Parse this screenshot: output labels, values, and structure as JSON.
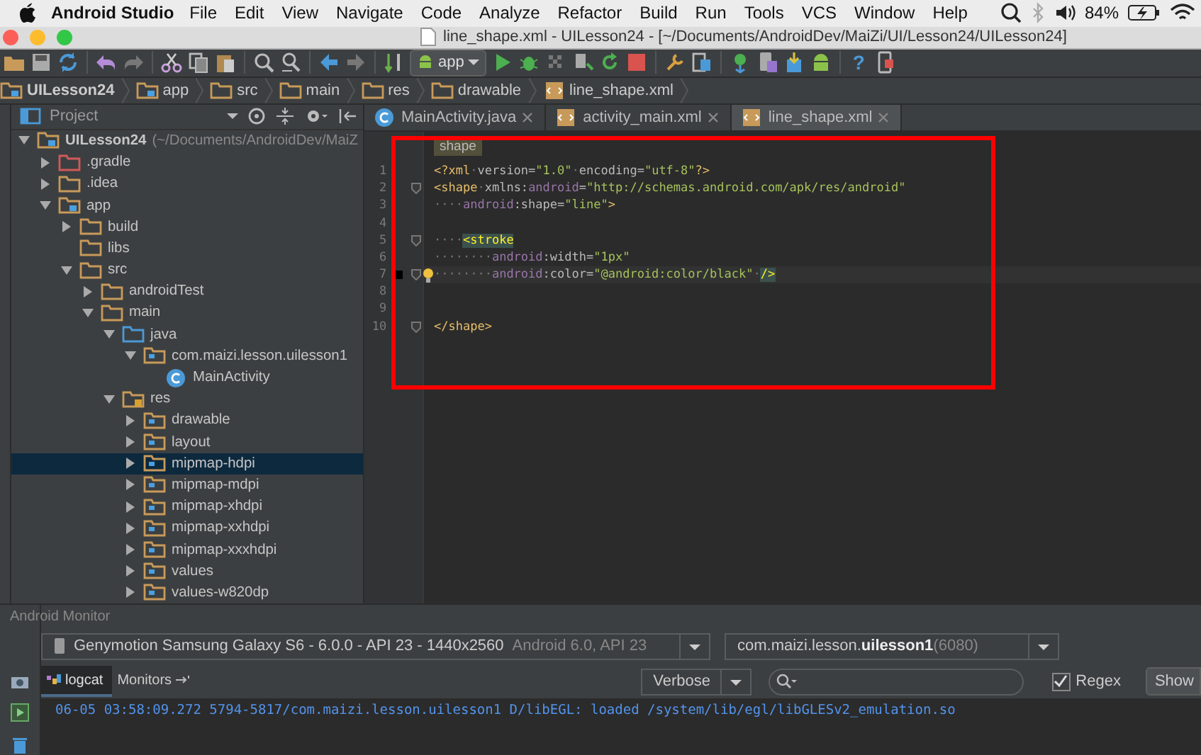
{
  "menu_bar": {
    "app_name": "Android Studio",
    "items": [
      "File",
      "Edit",
      "View",
      "Navigate",
      "Code",
      "Analyze",
      "Refactor",
      "Build",
      "Run",
      "Tools",
      "VCS",
      "Window",
      "Help"
    ],
    "battery": "84%"
  },
  "window": {
    "title": "line_shape.xml - UILesson24 - [~/Documents/AndroidDev/MaiZi/UI/Lesson24/UILesson24]"
  },
  "toolbar": {
    "run_config": "app",
    "help": "?"
  },
  "breadcrumbs": [
    {
      "label": "UILesson24",
      "kind": "module"
    },
    {
      "label": "app",
      "kind": "module"
    },
    {
      "label": "src",
      "kind": "folder"
    },
    {
      "label": "main",
      "kind": "folder"
    },
    {
      "label": "res",
      "kind": "folder"
    },
    {
      "label": "drawable",
      "kind": "folder"
    },
    {
      "label": "line_shape.xml",
      "kind": "xml"
    }
  ],
  "project_panel": {
    "title": "Project",
    "tree": [
      {
        "label": "UILesson24",
        "note": "(~/Documents/AndroidDev/MaiZ",
        "kind": "module",
        "arrow": true,
        "expanded": true,
        "selected": false,
        "children": [
          {
            "label": ".gradle",
            "kind": "excluded",
            "arrow": true,
            "expanded": false,
            "selected": false
          },
          {
            "label": ".idea",
            "kind": "folder",
            "arrow": true,
            "expanded": false,
            "selected": false
          },
          {
            "label": "app",
            "kind": "module",
            "arrow": true,
            "expanded": true,
            "selected": false,
            "children": [
              {
                "label": "build",
                "kind": "folder",
                "arrow": true,
                "expanded": false,
                "selected": false
              },
              {
                "label": "libs",
                "kind": "folder",
                "arrow": false,
                "selected": false
              },
              {
                "label": "src",
                "kind": "folder",
                "arrow": true,
                "expanded": true,
                "selected": false,
                "children": [
                  {
                    "label": "androidTest",
                    "kind": "folder",
                    "arrow": true,
                    "expanded": false,
                    "selected": false
                  },
                  {
                    "label": "main",
                    "kind": "folder",
                    "arrow": true,
                    "expanded": true,
                    "selected": false,
                    "children": [
                      {
                        "label": "java",
                        "kind": "source",
                        "arrow": true,
                        "expanded": true,
                        "selected": false,
                        "children": [
                          {
                            "label": "com.maizi.lesson.uilesson1",
                            "kind": "package",
                            "arrow": true,
                            "expanded": true,
                            "selected": false,
                            "children": [
                              {
                                "label": "MainActivity",
                                "kind": "class",
                                "arrow": false,
                                "selected": false
                              }
                            ]
                          }
                        ]
                      },
                      {
                        "label": "res",
                        "kind": "resources",
                        "arrow": true,
                        "expanded": true,
                        "selected": false,
                        "children": [
                          {
                            "label": "drawable",
                            "kind": "package",
                            "arrow": true,
                            "expanded": false,
                            "selected": false
                          },
                          {
                            "label": "layout",
                            "kind": "package",
                            "arrow": true,
                            "expanded": false,
                            "selected": false
                          },
                          {
                            "label": "mipmap-hdpi",
                            "kind": "package",
                            "arrow": true,
                            "expanded": false,
                            "selected": true
                          },
                          {
                            "label": "mipmap-mdpi",
                            "kind": "package",
                            "arrow": true,
                            "expanded": false,
                            "selected": false
                          },
                          {
                            "label": "mipmap-xhdpi",
                            "kind": "package",
                            "arrow": true,
                            "expanded": false,
                            "selected": false
                          },
                          {
                            "label": "mipmap-xxhdpi",
                            "kind": "package",
                            "arrow": true,
                            "expanded": false,
                            "selected": false
                          },
                          {
                            "label": "mipmap-xxxhdpi",
                            "kind": "package",
                            "arrow": true,
                            "expanded": false,
                            "selected": false
                          },
                          {
                            "label": "values",
                            "kind": "package",
                            "arrow": true,
                            "expanded": false,
                            "selected": false
                          },
                          {
                            "label": "values-w820dp",
                            "kind": "package",
                            "arrow": true,
                            "expanded": false,
                            "selected": false
                          }
                        ]
                      }
                    ]
                  }
                ]
              }
            ]
          }
        ]
      }
    ]
  },
  "editor": {
    "tabs": [
      {
        "label": "MainActivity.java",
        "kind": "class",
        "selected": false
      },
      {
        "label": "activity_main.xml",
        "kind": "xml",
        "selected": false
      },
      {
        "label": "line_shape.xml",
        "kind": "xml",
        "selected": true
      }
    ],
    "crumb": "shape",
    "annotation_frame": true,
    "lines": [
      {
        "number": "1",
        "fold": false,
        "current": false,
        "bulb": false,
        "marker": false,
        "tokens": [
          {
            "kind": "tag",
            "text": "<?xml"
          },
          {
            "kind": "ws",
            "text": "·"
          },
          {
            "kind": "attr",
            "text": "version="
          },
          {
            "kind": "value",
            "text": "\"1.0\""
          },
          {
            "kind": "ws",
            "text": "·"
          },
          {
            "kind": "attr",
            "text": "encoding="
          },
          {
            "kind": "value",
            "text": "\"utf-8\""
          },
          {
            "kind": "tag",
            "text": "?>"
          }
        ]
      },
      {
        "number": "2",
        "fold": true,
        "current": false,
        "bulb": false,
        "marker": false,
        "tokens": [
          {
            "kind": "tag",
            "text": "<shape"
          },
          {
            "kind": "ws",
            "text": "·"
          },
          {
            "kind": "attr",
            "text": "xmlns:"
          },
          {
            "kind": "ns",
            "text": "android"
          },
          {
            "kind": "attr",
            "text": "="
          },
          {
            "kind": "value",
            "text": "\"http://schemas.android.com/apk/res/android\""
          }
        ]
      },
      {
        "number": "3",
        "fold": false,
        "current": false,
        "bulb": false,
        "marker": false,
        "tokens": [
          {
            "kind": "ws",
            "text": "····"
          },
          {
            "kind": "ns",
            "text": "android"
          },
          {
            "kind": "attr",
            "text": ":shape="
          },
          {
            "kind": "value",
            "text": "\"line\""
          },
          {
            "kind": "tag",
            "text": ">"
          }
        ]
      },
      {
        "number": "4",
        "fold": false,
        "current": false,
        "bulb": false,
        "marker": false
      },
      {
        "number": "5",
        "fold": true,
        "current": false,
        "bulb": false,
        "marker": false,
        "tokens": [
          {
            "kind": "ws",
            "text": "····"
          },
          {
            "kind": "match",
            "text": "<stroke"
          }
        ]
      },
      {
        "number": "6",
        "fold": false,
        "current": false,
        "bulb": false,
        "marker": false,
        "tokens": [
          {
            "kind": "ws",
            "text": "········"
          },
          {
            "kind": "ns",
            "text": "android"
          },
          {
            "kind": "attr",
            "text": ":width="
          },
          {
            "kind": "value",
            "text": "\"1px\""
          }
        ]
      },
      {
        "number": "7",
        "fold": true,
        "current": true,
        "bulb": true,
        "marker": true,
        "tokens": [
          {
            "kind": "ws",
            "text": "········"
          },
          {
            "kind": "ns",
            "text": "android"
          },
          {
            "kind": "attr",
            "text": ":color="
          },
          {
            "kind": "value",
            "text": "\"@android:color/black\""
          },
          {
            "kind": "ws",
            "text": "·"
          },
          {
            "kind": "match",
            "text": "/>"
          }
        ]
      },
      {
        "number": "8",
        "fold": false,
        "current": false,
        "bulb": false,
        "marker": false
      },
      {
        "number": "9",
        "fold": false,
        "current": false,
        "bulb": false,
        "marker": false
      },
      {
        "number": "10",
        "fold": true,
        "current": false,
        "bulb": false,
        "marker": false,
        "tokens": [
          {
            "kind": "tag",
            "text": "</shape>"
          }
        ]
      }
    ]
  },
  "monitor": {
    "title": "Android Monitor",
    "device": {
      "name": "Genymotion Samsung Galaxy S6 - 6.0.0 - API 23 - 1440x2560",
      "detail": "Android 6.0, API 23"
    },
    "process": {
      "name": "com.maizi.lesson.**uilesson1**",
      "pid": "(6080)"
    },
    "tabs": [
      {
        "label": "logcat",
        "selected": true
      },
      {
        "label": "Monitors",
        "selected": false
      }
    ],
    "log_level": "Verbose",
    "regex": {
      "label": "Regex",
      "checked": true
    },
    "show_button": "Show",
    "log_lines": [
      "06-05 03:58:09.272 5794-5817/com.maizi.lesson.uilesson1 D/libEGL: loaded /system/lib/egl/libGLESv2_emulation.so"
    ]
  }
}
